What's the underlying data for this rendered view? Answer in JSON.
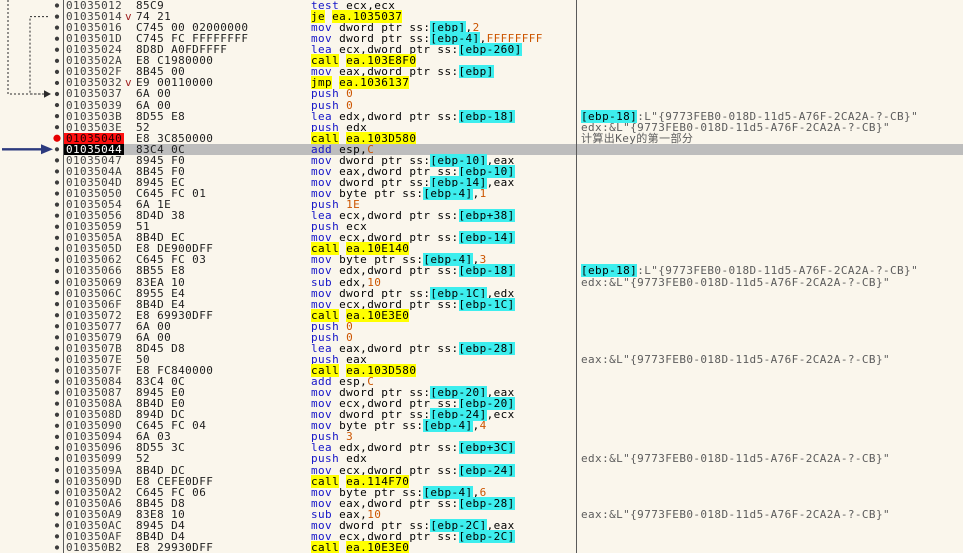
{
  "colors": {
    "background": "#FAF6EC",
    "selection_bg": "#BDBDBD",
    "address_text": "#424242",
    "bytes_text": "#1E1E1E",
    "mnemonic": "#1414C8",
    "immediate": "#CC5500",
    "memory_operand_bg": "#3DEEEE",
    "flow_bg": "#FFFF00",
    "flow_text": "#000000",
    "comment_text": "#5C5C5C",
    "breakpoint_bg": "#FF1010",
    "breakpoint_dot": "#E60000",
    "cip_address_bg": "#000000",
    "cip_address_text": "#FFFFFF",
    "jump_line": "#2B2B2B",
    "cip_arrow": "#2C3A7E",
    "separator": "#5A5A5A",
    "row_dot": "#3C3C3C",
    "dir_marker": "#A02020"
  },
  "disassembly": {
    "module_prefix": "ea",
    "flow_mnemonics": [
      "call",
      "jmp",
      "je",
      "jne",
      "ja",
      "jb",
      "jg",
      "jl",
      "jae",
      "jbe"
    ],
    "cip_row_index": 13,
    "breakpoint_row_index": 12,
    "jumps": [
      {
        "type": "from_above",
        "to_row_index": 8
      },
      {
        "type": "conditional",
        "from_row_index": 1,
        "to_row_index": 8
      }
    ],
    "rows": [
      {
        "addr": "01035012",
        "bytes": "85C9",
        "disasm": "test ecx,ecx"
      },
      {
        "addr": "01035014",
        "bytes": "74 21",
        "dir": "v",
        "disasm": "je ea.1035037"
      },
      {
        "addr": "01035016",
        "bytes": "C745 00 02000000",
        "disasm": "mov dword ptr ss:[ebp],2"
      },
      {
        "addr": "0103501D",
        "bytes": "C745 FC FFFFFFFF",
        "disasm": "mov dword ptr ss:[ebp-4],FFFFFFFF"
      },
      {
        "addr": "01035024",
        "bytes": "8D8D A0FDFFFF",
        "disasm": "lea ecx,dword ptr ss:[ebp-260]"
      },
      {
        "addr": "0103502A",
        "bytes": "E8 C1980000",
        "disasm": "call ea.103E8F0"
      },
      {
        "addr": "0103502F",
        "bytes": "8B45 00",
        "disasm": "mov eax,dword ptr ss:[ebp]"
      },
      {
        "addr": "01035032",
        "bytes": "E9 00110000",
        "dir": "v",
        "disasm": "jmp ea.1036137"
      },
      {
        "addr": "01035037",
        "bytes": "6A 00",
        "disasm": "push 0"
      },
      {
        "addr": "01035039",
        "bytes": "6A 00",
        "disasm": "push 0"
      },
      {
        "addr": "0103503B",
        "bytes": "8D55 E8",
        "disasm": "lea edx,dword ptr ss:[ebp-18]",
        "comment": "[ebp-18]:L\"{9773FEB0-018D-11d5-A76F-2CA2A-?-CB}\""
      },
      {
        "addr": "0103503E",
        "bytes": "52",
        "disasm": "push edx",
        "comment": "edx:&L\"{9773FEB0-018D-11d5-A76F-2CA2A-?-CB}\""
      },
      {
        "addr": "01035040",
        "bytes": "E8 3C850000",
        "disasm": "call ea.103D580",
        "comment": "计算出Key的第一部分",
        "bp": true
      },
      {
        "addr": "01035044",
        "bytes": "83C4 0C",
        "disasm": "add esp,C",
        "cip": true,
        "selected": true
      },
      {
        "addr": "01035047",
        "bytes": "8945 F0",
        "disasm": "mov dword ptr ss:[ebp-10],eax"
      },
      {
        "addr": "0103504A",
        "bytes": "8B45 F0",
        "disasm": "mov eax,dword ptr ss:[ebp-10]"
      },
      {
        "addr": "0103504D",
        "bytes": "8945 EC",
        "disasm": "mov dword ptr ss:[ebp-14],eax"
      },
      {
        "addr": "01035050",
        "bytes": "C645 FC 01",
        "disasm": "mov byte ptr ss:[ebp-4],1"
      },
      {
        "addr": "01035054",
        "bytes": "6A 1E",
        "disasm": "push 1E"
      },
      {
        "addr": "01035056",
        "bytes": "8D4D 38",
        "disasm": "lea ecx,dword ptr ss:[ebp+38]"
      },
      {
        "addr": "01035059",
        "bytes": "51",
        "disasm": "push ecx"
      },
      {
        "addr": "0103505A",
        "bytes": "8B4D EC",
        "disasm": "mov ecx,dword ptr ss:[ebp-14]"
      },
      {
        "addr": "0103505D",
        "bytes": "E8 DE900DFF",
        "disasm": "call ea.10E140"
      },
      {
        "addr": "01035062",
        "bytes": "C645 FC 03",
        "disasm": "mov byte ptr ss:[ebp-4],3"
      },
      {
        "addr": "01035066",
        "bytes": "8B55 E8",
        "disasm": "mov edx,dword ptr ss:[ebp-18]",
        "comment": "[ebp-18]:L\"{9773FEB0-018D-11d5-A76F-2CA2A-?-CB}\""
      },
      {
        "addr": "01035069",
        "bytes": "83EA 10",
        "disasm": "sub edx,10",
        "comment": "edx:&L\"{9773FEB0-018D-11d5-A76F-2CA2A-?-CB}\""
      },
      {
        "addr": "0103506C",
        "bytes": "8955 E4",
        "disasm": "mov dword ptr ss:[ebp-1C],edx"
      },
      {
        "addr": "0103506F",
        "bytes": "8B4D E4",
        "disasm": "mov ecx,dword ptr ss:[ebp-1C]"
      },
      {
        "addr": "01035072",
        "bytes": "E8 69930DFF",
        "disasm": "call ea.10E3E0"
      },
      {
        "addr": "01035077",
        "bytes": "6A 00",
        "disasm": "push 0"
      },
      {
        "addr": "01035079",
        "bytes": "6A 00",
        "disasm": "push 0"
      },
      {
        "addr": "0103507B",
        "bytes": "8D45 D8",
        "disasm": "lea eax,dword ptr ss:[ebp-28]"
      },
      {
        "addr": "0103507E",
        "bytes": "50",
        "disasm": "push eax",
        "comment": "eax:&L\"{9773FEB0-018D-11d5-A76F-2CA2A-?-CB}\""
      },
      {
        "addr": "0103507F",
        "bytes": "E8 FC840000",
        "disasm": "call ea.103D580"
      },
      {
        "addr": "01035084",
        "bytes": "83C4 0C",
        "disasm": "add esp,C"
      },
      {
        "addr": "01035087",
        "bytes": "8945 E0",
        "disasm": "mov dword ptr ss:[ebp-20],eax"
      },
      {
        "addr": "0103508A",
        "bytes": "8B4D E0",
        "disasm": "mov ecx,dword ptr ss:[ebp-20]"
      },
      {
        "addr": "0103508D",
        "bytes": "894D DC",
        "disasm": "mov dword ptr ss:[ebp-24],ecx"
      },
      {
        "addr": "01035090",
        "bytes": "C645 FC 04",
        "disasm": "mov byte ptr ss:[ebp-4],4"
      },
      {
        "addr": "01035094",
        "bytes": "6A 03",
        "disasm": "push 3"
      },
      {
        "addr": "01035096",
        "bytes": "8D55 3C",
        "disasm": "lea edx,dword ptr ss:[ebp+3C]"
      },
      {
        "addr": "01035099",
        "bytes": "52",
        "disasm": "push edx",
        "comment": "edx:&L\"{9773FEB0-018D-11d5-A76F-2CA2A-?-CB}\""
      },
      {
        "addr": "0103509A",
        "bytes": "8B4D DC",
        "disasm": "mov ecx,dword ptr ss:[ebp-24]"
      },
      {
        "addr": "0103509D",
        "bytes": "E8 CEFE0DFF",
        "disasm": "call ea.114F70"
      },
      {
        "addr": "010350A2",
        "bytes": "C645 FC 06",
        "disasm": "mov byte ptr ss:[ebp-4],6"
      },
      {
        "addr": "010350A6",
        "bytes": "8B45 D8",
        "disasm": "mov eax,dword ptr ss:[ebp-28]"
      },
      {
        "addr": "010350A9",
        "bytes": "83E8 10",
        "disasm": "sub eax,10",
        "comment": "eax:&L\"{9773FEB0-018D-11d5-A76F-2CA2A-?-CB}\""
      },
      {
        "addr": "010350AC",
        "bytes": "8945 D4",
        "disasm": "mov dword ptr ss:[ebp-2C],eax"
      },
      {
        "addr": "010350AF",
        "bytes": "8B4D D4",
        "disasm": "mov ecx,dword ptr ss:[ebp-2C]"
      },
      {
        "addr": "010350B2",
        "bytes": "E8 29930DFF",
        "disasm": "call ea.10E3E0"
      }
    ]
  }
}
